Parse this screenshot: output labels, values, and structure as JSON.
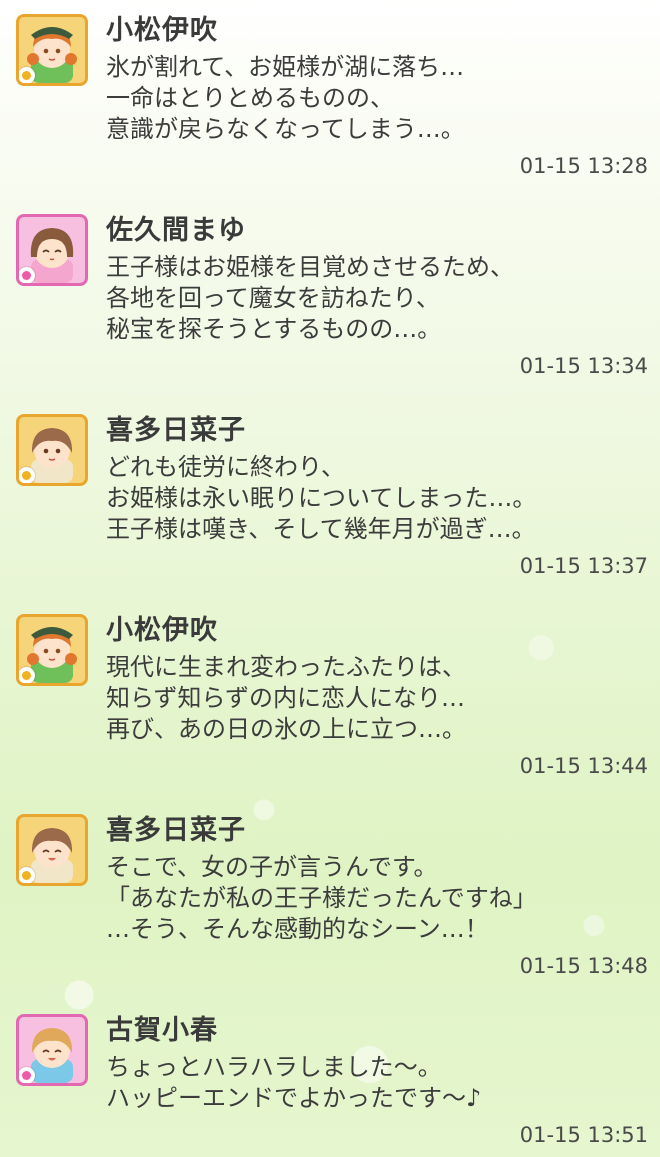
{
  "messages": [
    {
      "sender": "小松伊吹",
      "type": "cool",
      "lines": [
        "氷が割れて、お姫様が湖に落ち…",
        "一命はとりとめるものの、",
        "意識が戻らなくなってしまう…。"
      ],
      "time": "01-15 13:28"
    },
    {
      "sender": "佐久間まゆ",
      "type": "cute",
      "lines": [
        "王子様はお姫様を目覚めさせるため、",
        "各地を回って魔女を訪ねたり、",
        "秘宝を探そうとするものの…。"
      ],
      "time": "01-15 13:34"
    },
    {
      "sender": "喜多日菜子",
      "type": "cool",
      "lines": [
        "どれも徒労に終わり、",
        "お姫様は永い眠りについてしまった…。",
        "王子様は嘆き、そして幾年月が過ぎ…。"
      ],
      "time": "01-15 13:37"
    },
    {
      "sender": "小松伊吹",
      "type": "cool",
      "lines": [
        "現代に生まれ変わったふたりは、",
        "知らず知らずの内に恋人になり…",
        "再び、あの日の氷の上に立つ…。"
      ],
      "time": "01-15 13:44"
    },
    {
      "sender": "喜多日菜子",
      "type": "cool",
      "lines": [
        "そこで、女の子が言うんです。",
        "「あなたが私の王子様だったんですね」",
        "…そう、そんな感動的なシーン…！"
      ],
      "time": "01-15 13:48"
    },
    {
      "sender": "古賀小春",
      "type": "cute",
      "lines": [
        "ちょっとハラハラしました〜。",
        "ハッピーエンドでよかったです〜♪"
      ],
      "time": "01-15 13:51"
    }
  ],
  "colors": {
    "cool_frame": "#e8a62e",
    "cute_frame": "#e269b1"
  }
}
